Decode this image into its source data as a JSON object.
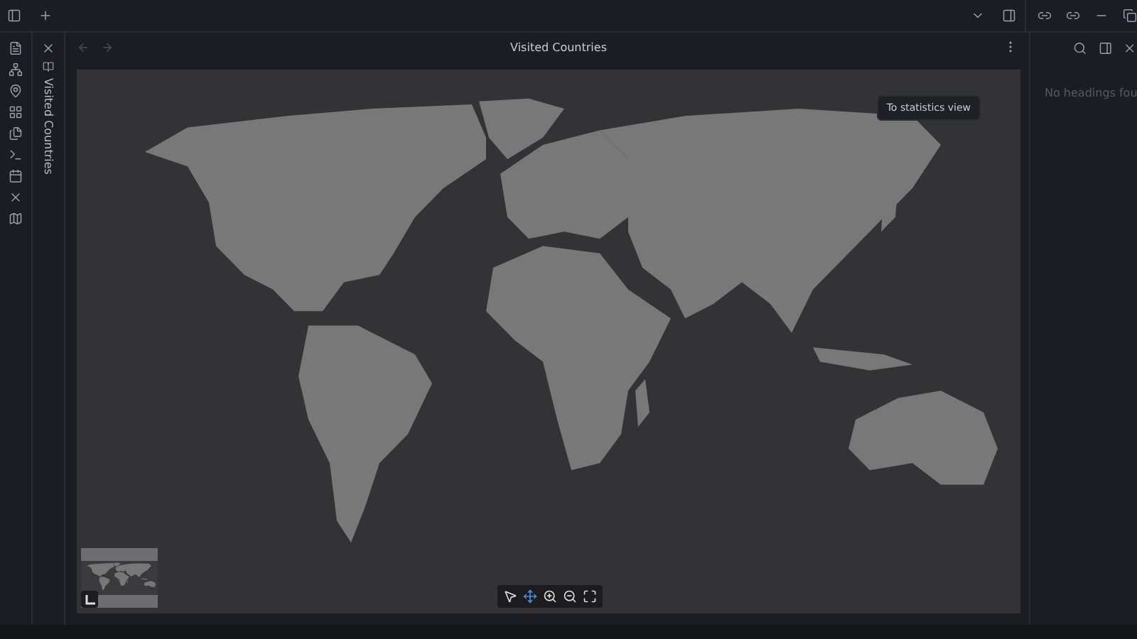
{
  "view": {
    "title": "Visited Countries"
  },
  "tab_strip": {
    "label": "Visited Countries"
  },
  "map": {
    "stats_button": "To statistics view",
    "tools": [
      {
        "kind": "select",
        "selected": false
      },
      {
        "kind": "pan",
        "selected": true
      },
      {
        "kind": "zoom-in",
        "selected": false
      },
      {
        "kind": "zoom-out",
        "selected": false
      },
      {
        "kind": "fit",
        "selected": false
      }
    ]
  },
  "outline": {
    "empty_message": "No headings fou"
  }
}
